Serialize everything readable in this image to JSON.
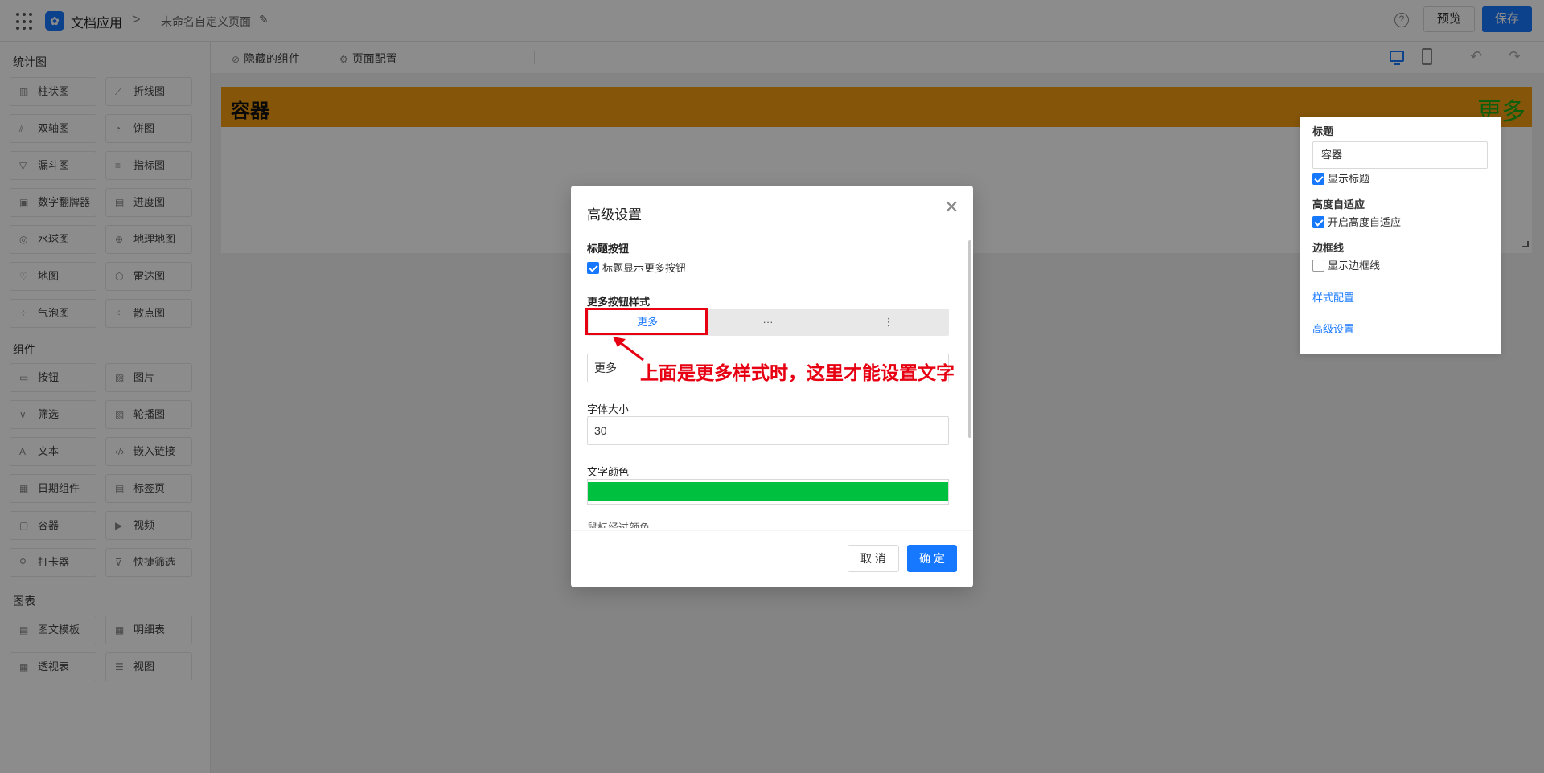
{
  "topbar": {
    "app_name": "文档应用",
    "crumb_separator": ">",
    "page_name": "未命名自定义页面",
    "help_icon": "?",
    "preview_label": "预览",
    "save_label": "保存"
  },
  "sidebar": {
    "sections": [
      {
        "title": "统计图",
        "items": [
          {
            "label": "柱状图",
            "icon": "bar-chart-icon"
          },
          {
            "label": "折线图",
            "icon": "line-chart-icon"
          },
          {
            "label": "双轴图",
            "icon": "dual-axis-icon"
          },
          {
            "label": "饼图",
            "icon": "pie-chart-icon"
          },
          {
            "label": "漏斗图",
            "icon": "funnel-icon"
          },
          {
            "label": "指标图",
            "icon": "indicator-icon"
          },
          {
            "label": "数字翻牌器",
            "icon": "number-flip-icon"
          },
          {
            "label": "进度图",
            "icon": "progress-icon"
          },
          {
            "label": "水球图",
            "icon": "liquid-icon"
          },
          {
            "label": "地理地图",
            "icon": "globe-icon"
          },
          {
            "label": "地图",
            "icon": "map-icon"
          },
          {
            "label": "雷达图",
            "icon": "radar-icon"
          },
          {
            "label": "气泡图",
            "icon": "bubble-icon"
          },
          {
            "label": "散点图",
            "icon": "scatter-icon"
          }
        ]
      },
      {
        "title": "组件",
        "items": [
          {
            "label": "按钮",
            "icon": "button-icon"
          },
          {
            "label": "图片",
            "icon": "image-icon"
          },
          {
            "label": "筛选",
            "icon": "filter-icon"
          },
          {
            "label": "轮播图",
            "icon": "carousel-icon"
          },
          {
            "label": "文本",
            "icon": "text-icon"
          },
          {
            "label": "嵌入链接",
            "icon": "embed-link-icon"
          },
          {
            "label": "日期组件",
            "icon": "calendar-icon"
          },
          {
            "label": "标签页",
            "icon": "tabs-icon"
          },
          {
            "label": "容器",
            "icon": "container-icon"
          },
          {
            "label": "视频",
            "icon": "video-icon"
          },
          {
            "label": "打卡器",
            "icon": "checkin-icon"
          },
          {
            "label": "快捷筛选",
            "icon": "quick-filter-icon"
          }
        ]
      },
      {
        "title": "图表",
        "items": [
          {
            "label": "图文模板",
            "icon": "template-icon"
          },
          {
            "label": "明细表",
            "icon": "detail-table-icon"
          },
          {
            "label": "透视表",
            "icon": "pivot-table-icon"
          },
          {
            "label": "视图",
            "icon": "view-icon"
          }
        ]
      }
    ]
  },
  "canvas_toolbar": {
    "hidden_components": "隐藏的组件",
    "page_config": "页面配置"
  },
  "canvas": {
    "container_title": "容器",
    "more_text": "更多",
    "header_color": "#f39c12",
    "more_color": "#1aad19"
  },
  "right_panel": {
    "title_label": "标题",
    "title_value": "容器",
    "show_title": "显示标题",
    "height_label": "高度自适应",
    "height_check": "开启高度自适应",
    "border_label": "边框线",
    "border_check": "显示边框线",
    "style_link": "样式配置",
    "advanced_link": "高级设置"
  },
  "modal": {
    "title": "高级设置",
    "title_button_label": "标题按钮",
    "title_button_check": "标题显示更多按钮",
    "more_style_label": "更多按钮样式",
    "style_options": [
      "更多",
      "···",
      "⋮"
    ],
    "more_text_value": "更多",
    "font_size_label": "字体大小",
    "font_size_value": "30",
    "text_color_label": "文字颜色",
    "text_color": "#00c040",
    "cut_label": "鼠标经过颜色",
    "cancel": "取 消",
    "ok": "确 定"
  },
  "annotation": {
    "text": "上面是更多样式时，这里才能设置文字",
    "color": "#e60012"
  }
}
